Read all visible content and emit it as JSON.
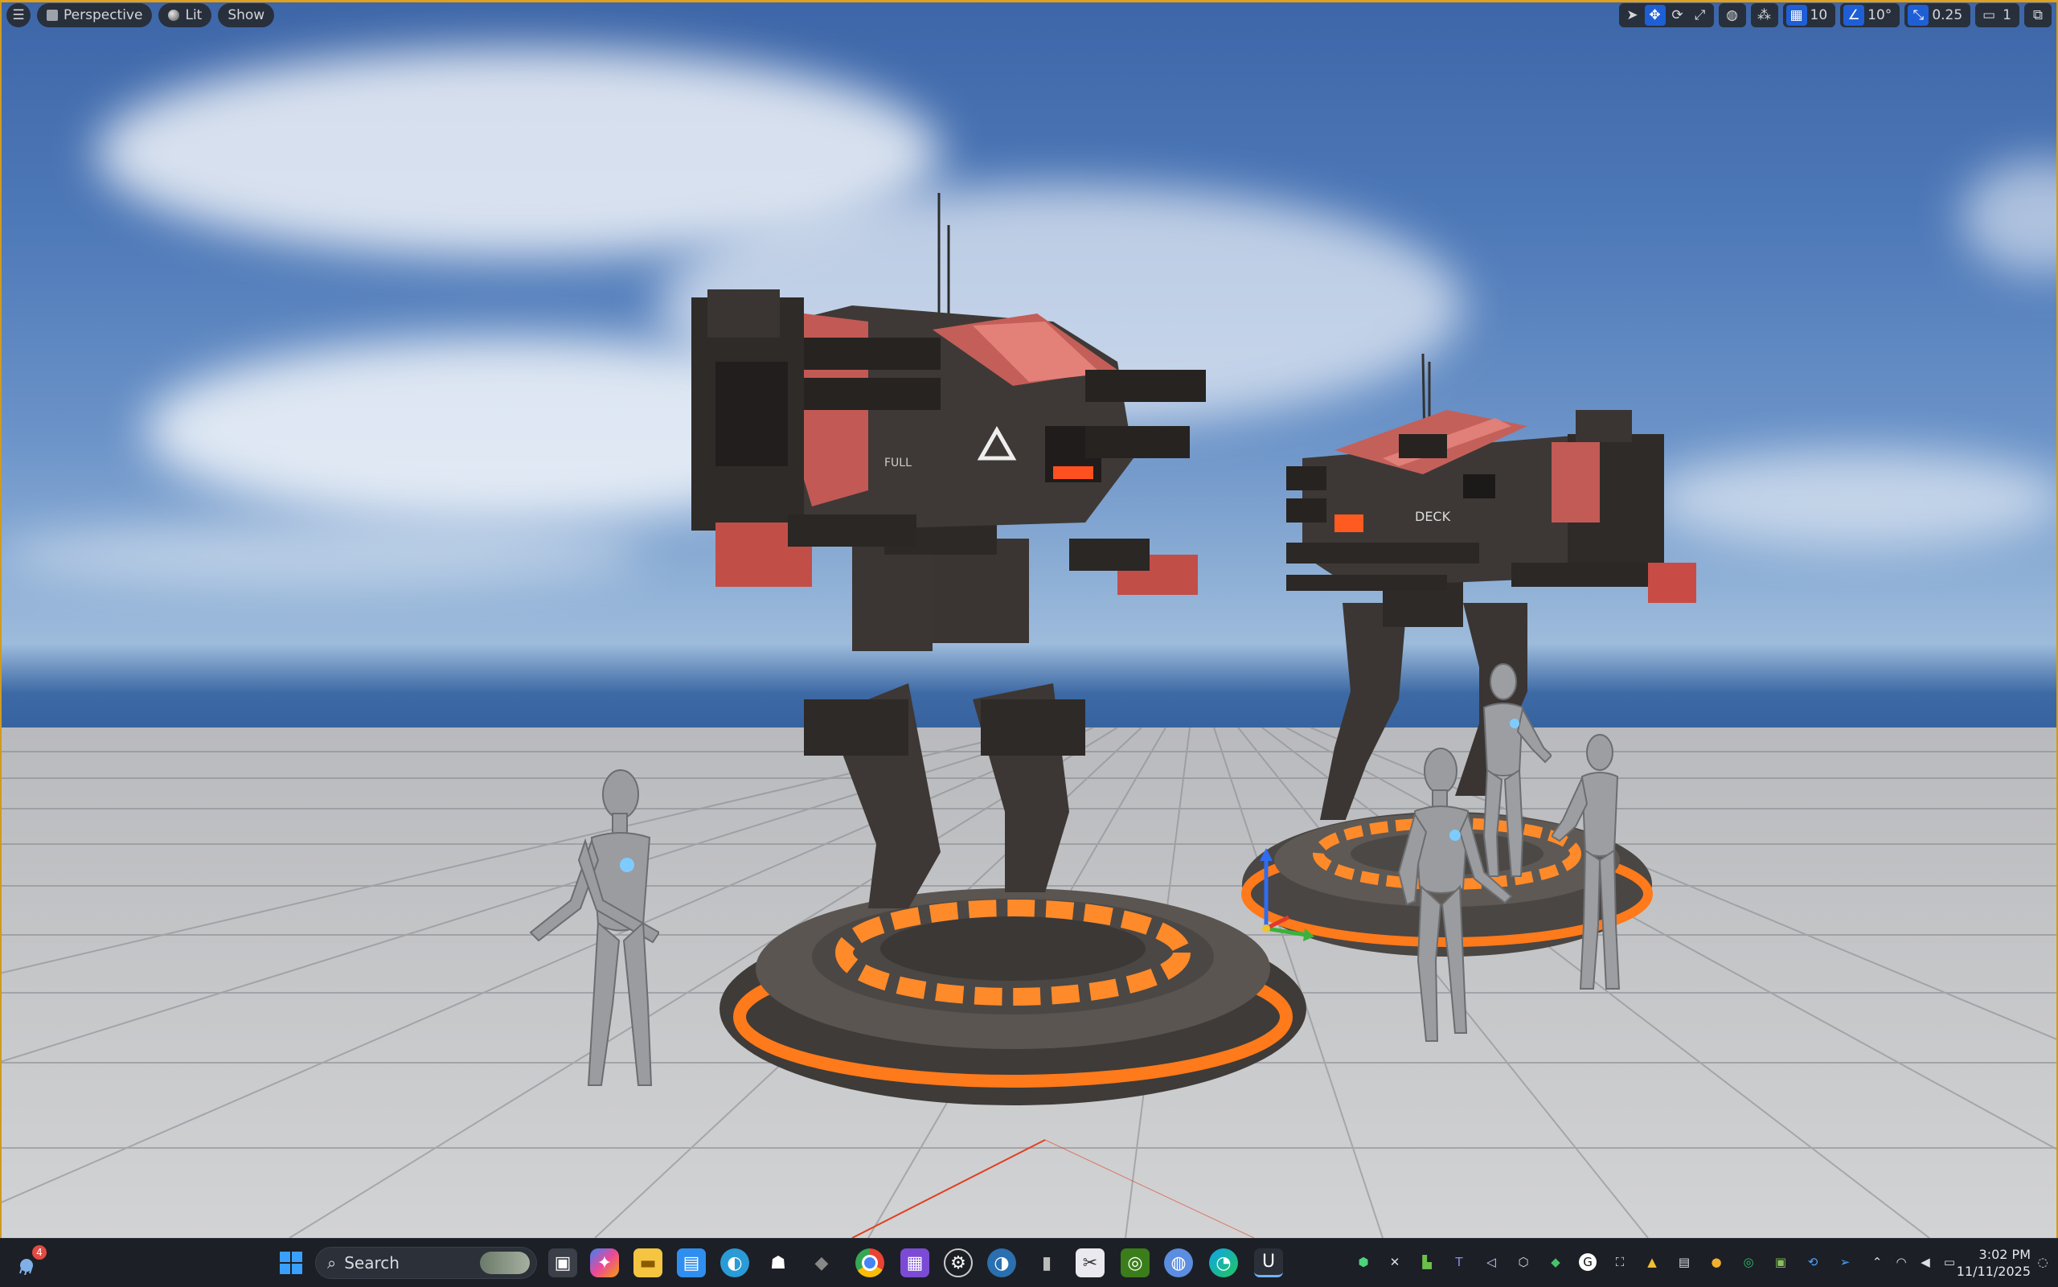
{
  "viewport": {
    "toolbar_left": {
      "perspective_label": "Perspective",
      "lit_label": "Lit",
      "show_label": "Show"
    },
    "toolbar_right": {
      "grid_snap_value": "10",
      "rotation_snap_value": "10°",
      "scale_snap_value": "0.25",
      "camera_speed_value": "1"
    },
    "mech_decals": {
      "front_mech_text": "FULL",
      "rear_mech_text": "DECK"
    },
    "colors": {
      "accent_gold": "#e0a020",
      "active_tool_blue": "#1f5fd6",
      "glow_orange": "#ff7a1a"
    }
  },
  "taskbar": {
    "search_placeholder": "Search",
    "notification_count": "4",
    "clock_time": "3:02 PM",
    "clock_date": "11/11/2025",
    "pinned_icons": [
      "start-icon",
      "task-view-icon",
      "copilot-icon",
      "file-explorer-icon",
      "microsoft-store-icon",
      "browser-icon",
      "alienware-icon",
      "app-icon",
      "chrome-icon",
      "media-icon",
      "steam-icon",
      "app-icon-2",
      "storage-icon",
      "snipping-icon",
      "nvidia-icon",
      "globe-icon",
      "edge-icon",
      "unreal-engine-icon"
    ],
    "tray_icons": [
      "tray-app-1",
      "xbox-icon",
      "tray-app-3",
      "teams-icon",
      "visual-studio-icon",
      "tray-app-6",
      "tray-app-7",
      "grammarly-icon",
      "tray-app-9",
      "tray-app-10",
      "tray-app-11",
      "tray-app-12",
      "tray-app-13",
      "tray-app-14",
      "tray-app-15",
      "tray-app-16",
      "tray-app-17",
      "wifi-icon",
      "volume-icon",
      "battery-icon"
    ]
  }
}
